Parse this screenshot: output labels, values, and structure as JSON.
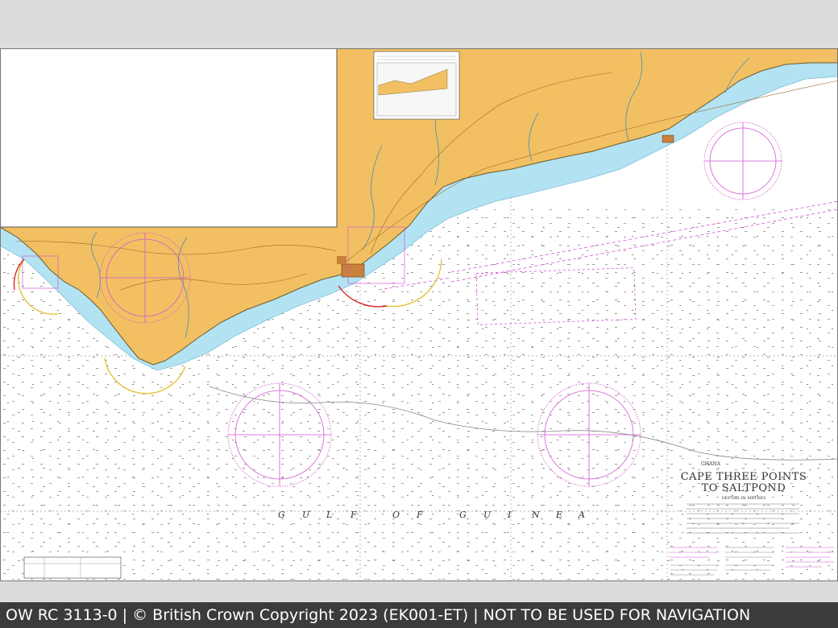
{
  "chart_sheet": {
    "country": "GHANA",
    "title_line1": "CAPE THREE POINTS",
    "title_line2": "TO SALTPOND",
    "depths_note": "DEPTHS IN METRES",
    "sea_name_letters": [
      "G",
      "U",
      "L",
      "F",
      "O",
      "F",
      "G",
      "U",
      "I",
      "N",
      "E",
      "A"
    ],
    "colors": {
      "land": "#f2c062",
      "shallow_water": "#b3e3f2",
      "deep_water": "#ffffff",
      "coast_line": "#6b5a2a",
      "compass_rose": "#d455d4",
      "routing_lines": "#d455d4",
      "sector_yellow": "#e3c43a",
      "sector_red": "#d9262b",
      "border_gray": "#dcdcdc",
      "footer_bg": "#3b3b3b"
    }
  },
  "footer": {
    "text": "OW RC 3113-0 | © British Crown Copyright 2023 (EK001-ET) | NOT TO BE USED FOR NAVIGATION"
  }
}
